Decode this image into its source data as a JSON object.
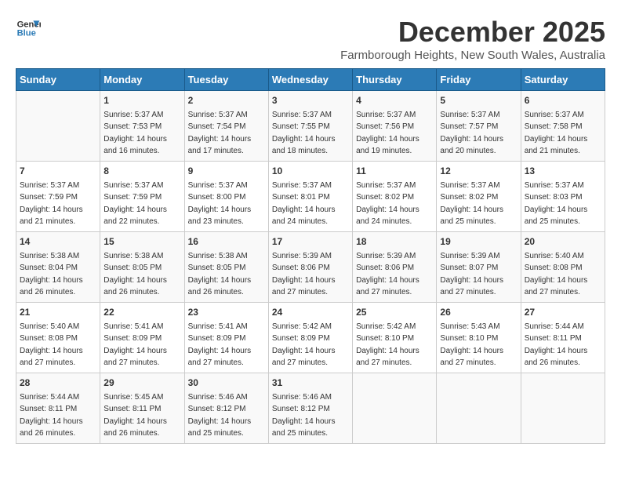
{
  "logo": {
    "line1": "General",
    "line2": "Blue"
  },
  "title": "December 2025",
  "subtitle": "Farmborough Heights, New South Wales, Australia",
  "days_of_week": [
    "Sunday",
    "Monday",
    "Tuesday",
    "Wednesday",
    "Thursday",
    "Friday",
    "Saturday"
  ],
  "weeks": [
    [
      {
        "day": "",
        "sunrise": "",
        "sunset": "",
        "daylight": ""
      },
      {
        "day": "1",
        "sunrise": "Sunrise: 5:37 AM",
        "sunset": "Sunset: 7:53 PM",
        "daylight": "Daylight: 14 hours and 16 minutes."
      },
      {
        "day": "2",
        "sunrise": "Sunrise: 5:37 AM",
        "sunset": "Sunset: 7:54 PM",
        "daylight": "Daylight: 14 hours and 17 minutes."
      },
      {
        "day": "3",
        "sunrise": "Sunrise: 5:37 AM",
        "sunset": "Sunset: 7:55 PM",
        "daylight": "Daylight: 14 hours and 18 minutes."
      },
      {
        "day": "4",
        "sunrise": "Sunrise: 5:37 AM",
        "sunset": "Sunset: 7:56 PM",
        "daylight": "Daylight: 14 hours and 19 minutes."
      },
      {
        "day": "5",
        "sunrise": "Sunrise: 5:37 AM",
        "sunset": "Sunset: 7:57 PM",
        "daylight": "Daylight: 14 hours and 20 minutes."
      },
      {
        "day": "6",
        "sunrise": "Sunrise: 5:37 AM",
        "sunset": "Sunset: 7:58 PM",
        "daylight": "Daylight: 14 hours and 21 minutes."
      }
    ],
    [
      {
        "day": "7",
        "sunrise": "Sunrise: 5:37 AM",
        "sunset": "Sunset: 7:59 PM",
        "daylight": "Daylight: 14 hours and 21 minutes."
      },
      {
        "day": "8",
        "sunrise": "Sunrise: 5:37 AM",
        "sunset": "Sunset: 7:59 PM",
        "daylight": "Daylight: 14 hours and 22 minutes."
      },
      {
        "day": "9",
        "sunrise": "Sunrise: 5:37 AM",
        "sunset": "Sunset: 8:00 PM",
        "daylight": "Daylight: 14 hours and 23 minutes."
      },
      {
        "day": "10",
        "sunrise": "Sunrise: 5:37 AM",
        "sunset": "Sunset: 8:01 PM",
        "daylight": "Daylight: 14 hours and 24 minutes."
      },
      {
        "day": "11",
        "sunrise": "Sunrise: 5:37 AM",
        "sunset": "Sunset: 8:02 PM",
        "daylight": "Daylight: 14 hours and 24 minutes."
      },
      {
        "day": "12",
        "sunrise": "Sunrise: 5:37 AM",
        "sunset": "Sunset: 8:02 PM",
        "daylight": "Daylight: 14 hours and 25 minutes."
      },
      {
        "day": "13",
        "sunrise": "Sunrise: 5:37 AM",
        "sunset": "Sunset: 8:03 PM",
        "daylight": "Daylight: 14 hours and 25 minutes."
      }
    ],
    [
      {
        "day": "14",
        "sunrise": "Sunrise: 5:38 AM",
        "sunset": "Sunset: 8:04 PM",
        "daylight": "Daylight: 14 hours and 26 minutes."
      },
      {
        "day": "15",
        "sunrise": "Sunrise: 5:38 AM",
        "sunset": "Sunset: 8:05 PM",
        "daylight": "Daylight: 14 hours and 26 minutes."
      },
      {
        "day": "16",
        "sunrise": "Sunrise: 5:38 AM",
        "sunset": "Sunset: 8:05 PM",
        "daylight": "Daylight: 14 hours and 26 minutes."
      },
      {
        "day": "17",
        "sunrise": "Sunrise: 5:39 AM",
        "sunset": "Sunset: 8:06 PM",
        "daylight": "Daylight: 14 hours and 27 minutes."
      },
      {
        "day": "18",
        "sunrise": "Sunrise: 5:39 AM",
        "sunset": "Sunset: 8:06 PM",
        "daylight": "Daylight: 14 hours and 27 minutes."
      },
      {
        "day": "19",
        "sunrise": "Sunrise: 5:39 AM",
        "sunset": "Sunset: 8:07 PM",
        "daylight": "Daylight: 14 hours and 27 minutes."
      },
      {
        "day": "20",
        "sunrise": "Sunrise: 5:40 AM",
        "sunset": "Sunset: 8:08 PM",
        "daylight": "Daylight: 14 hours and 27 minutes."
      }
    ],
    [
      {
        "day": "21",
        "sunrise": "Sunrise: 5:40 AM",
        "sunset": "Sunset: 8:08 PM",
        "daylight": "Daylight: 14 hours and 27 minutes."
      },
      {
        "day": "22",
        "sunrise": "Sunrise: 5:41 AM",
        "sunset": "Sunset: 8:09 PM",
        "daylight": "Daylight: 14 hours and 27 minutes."
      },
      {
        "day": "23",
        "sunrise": "Sunrise: 5:41 AM",
        "sunset": "Sunset: 8:09 PM",
        "daylight": "Daylight: 14 hours and 27 minutes."
      },
      {
        "day": "24",
        "sunrise": "Sunrise: 5:42 AM",
        "sunset": "Sunset: 8:09 PM",
        "daylight": "Daylight: 14 hours and 27 minutes."
      },
      {
        "day": "25",
        "sunrise": "Sunrise: 5:42 AM",
        "sunset": "Sunset: 8:10 PM",
        "daylight": "Daylight: 14 hours and 27 minutes."
      },
      {
        "day": "26",
        "sunrise": "Sunrise: 5:43 AM",
        "sunset": "Sunset: 8:10 PM",
        "daylight": "Daylight: 14 hours and 27 minutes."
      },
      {
        "day": "27",
        "sunrise": "Sunrise: 5:44 AM",
        "sunset": "Sunset: 8:11 PM",
        "daylight": "Daylight: 14 hours and 26 minutes."
      }
    ],
    [
      {
        "day": "28",
        "sunrise": "Sunrise: 5:44 AM",
        "sunset": "Sunset: 8:11 PM",
        "daylight": "Daylight: 14 hours and 26 minutes."
      },
      {
        "day": "29",
        "sunrise": "Sunrise: 5:45 AM",
        "sunset": "Sunset: 8:11 PM",
        "daylight": "Daylight: 14 hours and 26 minutes."
      },
      {
        "day": "30",
        "sunrise": "Sunrise: 5:46 AM",
        "sunset": "Sunset: 8:12 PM",
        "daylight": "Daylight: 14 hours and 25 minutes."
      },
      {
        "day": "31",
        "sunrise": "Sunrise: 5:46 AM",
        "sunset": "Sunset: 8:12 PM",
        "daylight": "Daylight: 14 hours and 25 minutes."
      },
      {
        "day": "",
        "sunrise": "",
        "sunset": "",
        "daylight": ""
      },
      {
        "day": "",
        "sunrise": "",
        "sunset": "",
        "daylight": ""
      },
      {
        "day": "",
        "sunrise": "",
        "sunset": "",
        "daylight": ""
      }
    ]
  ]
}
